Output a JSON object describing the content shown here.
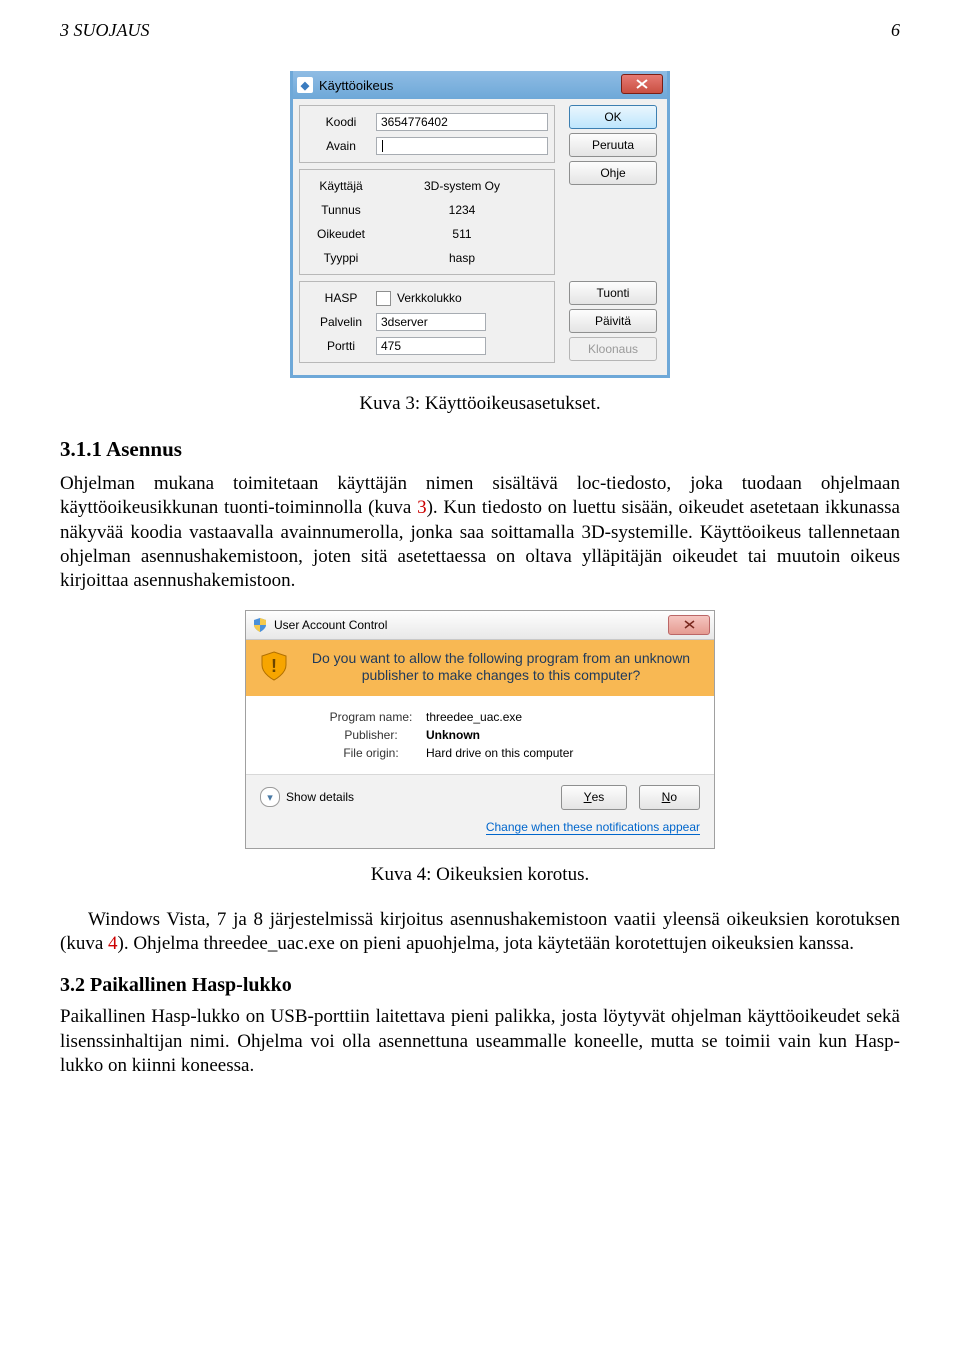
{
  "running_header": {
    "left": "3   SUOJAUS",
    "right": "6"
  },
  "fig1": {
    "title": "Käyttöoikeus",
    "rows": {
      "koodi_label": "Koodi",
      "koodi_value": "3654776402",
      "avain_label": "Avain",
      "avain_value": "",
      "kayttaja_label": "Käyttäjä",
      "kayttaja_value": "3D-system Oy",
      "tunnus_label": "Tunnus",
      "tunnus_value": "1234",
      "oikeudet_label": "Oikeudet",
      "oikeudet_value": "511",
      "tyyppi_label": "Tyyppi",
      "tyyppi_value": "hasp",
      "hasp_label": "HASP",
      "hasp_chk_label": "Verkkolukko",
      "palvelin_label": "Palvelin",
      "palvelin_value": "3dserver",
      "portti_label": "Portti",
      "portti_value": "475"
    },
    "buttons": {
      "ok": "OK",
      "peruuta": "Peruuta",
      "ohje": "Ohje",
      "tuonti": "Tuonti",
      "paivita": "Päivitä",
      "kloonaus": "Kloonaus"
    },
    "caption": "Kuva 3: Käyttöoikeusasetukset."
  },
  "sec311": {
    "heading": "3.1.1   Asennus",
    "p1_a": "Ohjelman mukana toimitetaan käyttäjän nimen sisältävä loc-tiedosto, joka tuodaan ohjelmaan käyttöoikeusikkunan tuonti-toiminnolla (kuva ",
    "p1_ref": "3",
    "p1_b": "). Kun tiedosto on luettu sisään, oikeudet asetetaan ikkunassa näkyvää koodia vastaavalla avainnumerolla, jonka saa soittamalla 3D-systemille. Käyttöoikeus tallennetaan ohjelman asennushakemistoon, joten sitä asetettaessa on oltava ylläpitäjän oikeudet tai muutoin oikeus kirjoittaa asennushakemistoon."
  },
  "fig2": {
    "title": "User Account Control",
    "banner": "Do you want to allow the following program from an unknown publisher to make changes to this computer?",
    "program_label": "Program name:",
    "program_value": "threedee_uac.exe",
    "publisher_label": "Publisher:",
    "publisher_value": "Unknown",
    "origin_label": "File origin:",
    "origin_value": "Hard drive on this computer",
    "show_details": "Show details",
    "yes_u": "Y",
    "yes_rest": "es",
    "no_u": "N",
    "no_rest": "o",
    "link": "Change when these notifications appear",
    "caption": "Kuva 4: Oikeuksien korotus."
  },
  "p_after_fig2_a": "Windows Vista, 7 ja 8 järjestelmissä kirjoitus asennushakemistoon vaatii yleensä oikeuksien korotuksen (kuva ",
  "p_after_fig2_ref": "4",
  "p_after_fig2_b": "). Ohjelma threedee_uac.exe on pieni apuohjelma, jota käytetään korotettujen oikeuksien kanssa.",
  "sec32": {
    "heading": "3.2   Paikallinen Hasp-lukko",
    "p": "Paikallinen Hasp-lukko on USB-porttiin laitettava pieni palikka, josta löytyvät ohjelman käyttöoikeudet sekä lisenssinhaltijan nimi. Ohjelma voi olla asennettuna useammalle koneelle, mutta se toimii vain kun Hasp-lukko on kiinni koneessa."
  }
}
